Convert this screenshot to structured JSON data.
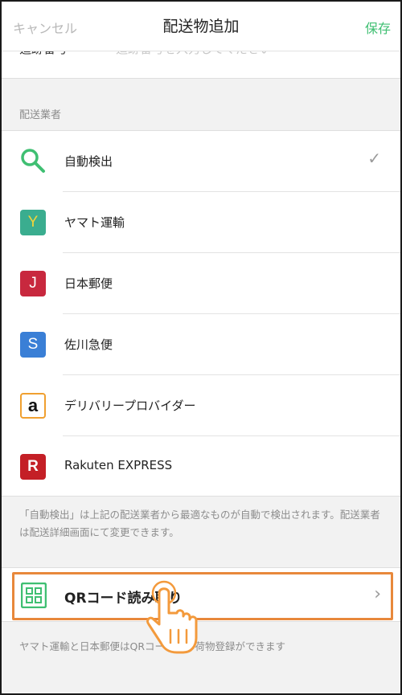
{
  "header": {
    "cancel_label": "キャンセル",
    "title": "配送物追加",
    "save_label": "保存"
  },
  "tracking": {
    "label": "追跡番号",
    "placeholder": "追跡番号を入力してください"
  },
  "carrier_section": {
    "label": "配送業者",
    "items": [
      {
        "name": "自動検出",
        "icon": "search-icon",
        "selected": true
      },
      {
        "name": "ヤマト運輸",
        "badge": "Y",
        "color": "#3aad8f",
        "text_color": "#f2d43a"
      },
      {
        "name": "日本郵便",
        "badge": "J",
        "color": "#c8283e",
        "text_color": "#ffffff"
      },
      {
        "name": "佐川急便",
        "badge": "S",
        "color": "#3a7fd6",
        "text_color": "#ffffff"
      },
      {
        "name": "デリバリープロバイダー",
        "badge": "a",
        "color": "#ffffff",
        "text_color": "#111111",
        "border": "#f0a030"
      },
      {
        "name": "Rakuten EXPRESS",
        "badge": "R",
        "color": "#c41f26",
        "text_color": "#ffffff"
      }
    ]
  },
  "auto_detect_note": "「自動検出」は上記の配送業者から最適なものが自動で検出されます。配送業者は配送詳細画面にて変更できます。",
  "qr": {
    "label": "QRコード読み取り",
    "icon": "qr-grid-icon",
    "note": "ヤマト運輸と日本郵便はQRコードから荷物登録ができます"
  },
  "colors": {
    "accent": "#3fbf72",
    "highlight": "#e8883b",
    "hand": "#f39a3c"
  }
}
